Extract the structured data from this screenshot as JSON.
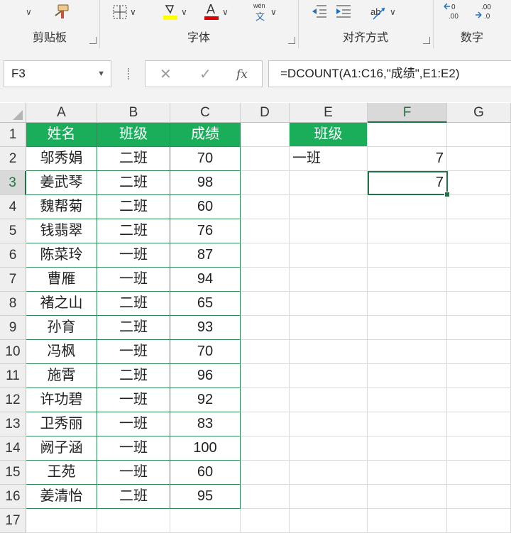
{
  "ribbon": {
    "groups": [
      {
        "label": "剪贴板"
      },
      {
        "label": "字体"
      },
      {
        "label": "对齐方式"
      },
      {
        "label": "数字"
      }
    ],
    "pinyin_small": "wén",
    "pinyin_char": "文",
    "font_color_letter": "A",
    "highlight_color": "#ffff00",
    "font_color": "#e00000"
  },
  "formula_bar": {
    "name_box": "F3",
    "cancel_icon": "✕",
    "enter_icon": "✓",
    "fx_label": "fx",
    "formula": "=DCOUNT(A1:C16,\"成绩\",E1:E2)"
  },
  "columns": [
    "A",
    "B",
    "C",
    "D",
    "E",
    "F",
    "G"
  ],
  "selected_column": "F",
  "rows": [
    "1",
    "2",
    "3",
    "4",
    "5",
    "6",
    "7",
    "8",
    "9",
    "10",
    "11",
    "12",
    "13",
    "14",
    "15",
    "16",
    "17"
  ],
  "selected_row": "3",
  "table": {
    "headers": [
      "姓名",
      "班级",
      "成绩"
    ],
    "records": [
      [
        "邬秀娟",
        "二班",
        "70"
      ],
      [
        "姜武琴",
        "二班",
        "98"
      ],
      [
        "魏帮菊",
        "二班",
        "60"
      ],
      [
        "钱翡翠",
        "二班",
        "76"
      ],
      [
        "陈菜玲",
        "一班",
        "87"
      ],
      [
        "曹雁",
        "一班",
        "94"
      ],
      [
        "褚之山",
        "二班",
        "65"
      ],
      [
        "孙育",
        "二班",
        "93"
      ],
      [
        "冯枫",
        "一班",
        "70"
      ],
      [
        "施霄",
        "二班",
        "96"
      ],
      [
        "许功碧",
        "一班",
        "92"
      ],
      [
        "卫秀丽",
        "一班",
        "83"
      ],
      [
        "阙子涵",
        "一班",
        "100"
      ],
      [
        "王苑",
        "一班",
        "60"
      ],
      [
        "姜清怡",
        "二班",
        "95"
      ]
    ]
  },
  "criteria": {
    "header": "班级",
    "value": "一班"
  },
  "results": {
    "f2": "7",
    "f3": "7"
  },
  "colors": {
    "table_header": "#1aae5a",
    "accent": "#217346"
  }
}
